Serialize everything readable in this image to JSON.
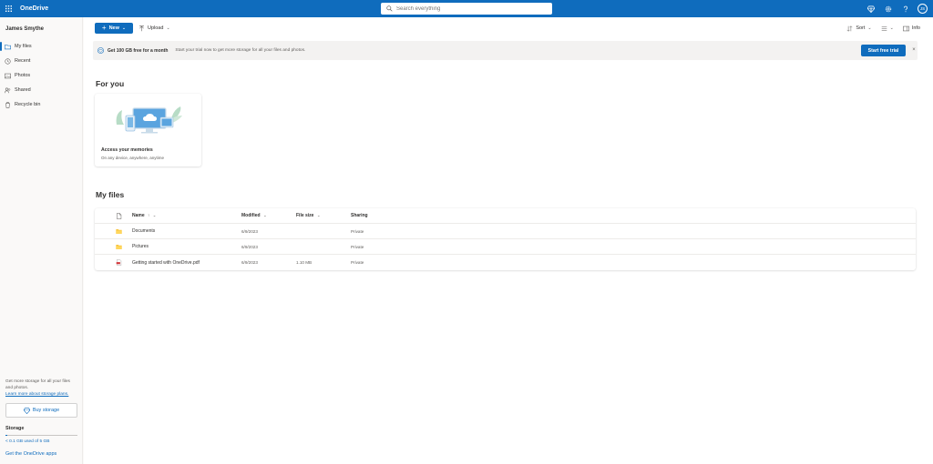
{
  "app": {
    "title": "OneDrive"
  },
  "search": {
    "placeholder": "Search everything"
  },
  "user": {
    "name": "James Smythe",
    "initials": "JS"
  },
  "sidebar": {
    "items": [
      {
        "label": "My files",
        "icon": "folder-icon",
        "active": true
      },
      {
        "label": "Recent",
        "icon": "clock-icon"
      },
      {
        "label": "Photos",
        "icon": "image-icon"
      },
      {
        "label": "Shared",
        "icon": "people-icon"
      },
      {
        "label": "Recycle bin",
        "icon": "trash-icon"
      }
    ],
    "promo_text": "Get more storage for all your files and photos.",
    "promo_link": "Learn more about storage plans.",
    "buy_label": "Buy storage",
    "storage_label": "Storage",
    "storage_used_text": "< 0.1 GB used of 5 GB",
    "storage_fraction": 0.02,
    "get_apps": "Get the OneDrive apps"
  },
  "toolbar": {
    "new_label": "New",
    "upload_label": "Upload",
    "sort_label": "Sort",
    "info_label": "Info"
  },
  "banner": {
    "title": "Get 100 GB free for a month",
    "description": "Start your trial now to get more storage for all your files and photos.",
    "cta": "Start free trial"
  },
  "for_you": {
    "title": "For you",
    "card_title": "Access your memories",
    "card_subtitle": "On any device, anywhere, anytime"
  },
  "my_files": {
    "title": "My files",
    "columns": {
      "name": "Name",
      "name_sort": "↑",
      "modified": "Modified",
      "size": "File size",
      "sharing": "Sharing"
    },
    "rows": [
      {
        "name": "Documents",
        "type": "folder",
        "modified": "6/9/2023",
        "size": "",
        "sharing": "Private"
      },
      {
        "name": "Pictures",
        "type": "folder",
        "modified": "6/9/2023",
        "size": "",
        "sharing": "Private"
      },
      {
        "name": "Getting started with OneDrive.pdf",
        "type": "pdf",
        "modified": "6/9/2023",
        "size": "1.10 MB",
        "sharing": "Private"
      }
    ]
  },
  "colors": {
    "brand": "#0f6cbd",
    "folder": "#f8c33b",
    "pdf": "#d13438"
  }
}
